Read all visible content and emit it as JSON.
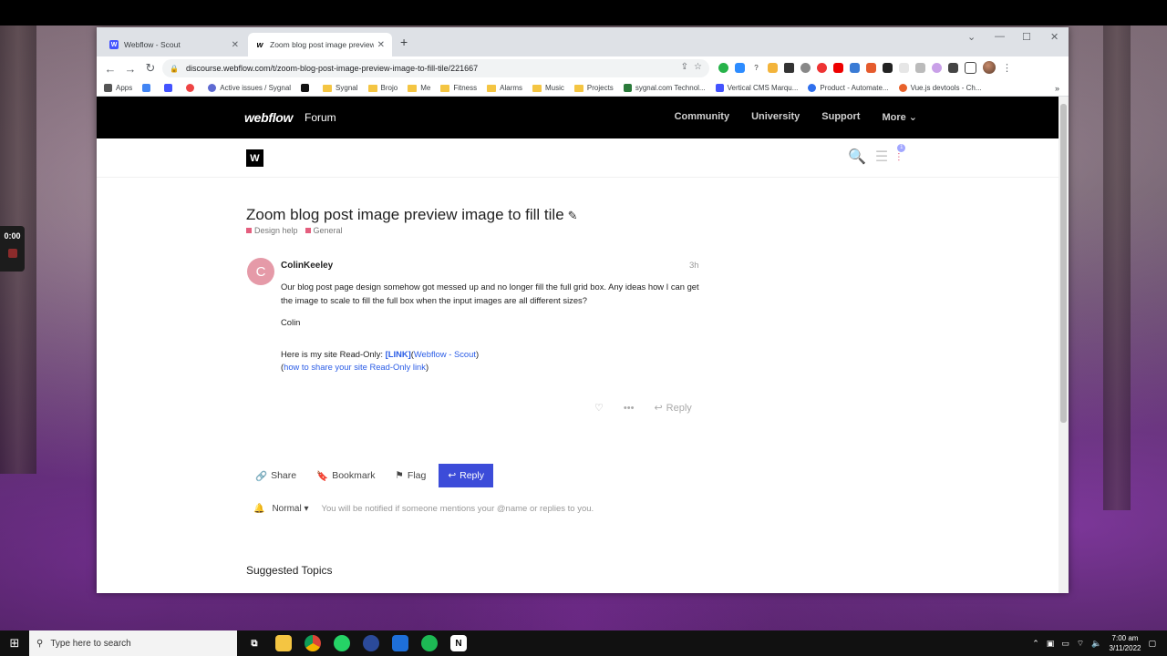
{
  "recorder": {
    "time": "0:00"
  },
  "browser": {
    "tabs": [
      {
        "title": "Webflow - Scout",
        "icon": "webflow-w"
      },
      {
        "title": "Zoom blog post image preview i",
        "icon": "webflow-w"
      }
    ],
    "new_tab_symbol": "+",
    "url": "discourse.webflow.com/t/zoom-blog-post-image-preview-image-to-fill-tile/221667",
    "bookmarks": [
      "Apps",
      "Active issues / Sygnal",
      "Sygnal",
      "Brojo",
      "Me",
      "Fitness",
      "Alarms",
      "Music",
      "Projects",
      "sygnal.com Technol...",
      "Vertical CMS Marqu...",
      "Product - Automate...",
      "Vue.js devtools - Ch..."
    ]
  },
  "site_header": {
    "logo": "webflow",
    "forum": "Forum",
    "nav": [
      "Community",
      "University",
      "Support",
      "More"
    ]
  },
  "discourse": {
    "logo_letter": "W",
    "notification_count": "1"
  },
  "topic": {
    "title": "Zoom blog post image preview image to fill tile",
    "categories": [
      "Design help",
      "General"
    ],
    "post": {
      "avatar_letter": "C",
      "username": "ColinKeeley",
      "time": "3h",
      "paragraph1": "Our blog post page design somehow got messed up and no longer fill the full grid box. Any ideas how I can get the image to scale to fill the full box when the input images are all different sizes?",
      "signature": "Colin",
      "readonly_prefix": "Here is my site Read-Only: ",
      "readonly_link": "[LINK]",
      "readonly_paren_open": "(",
      "readonly_site": "Webflow - Scout",
      "readonly_paren_close": ")",
      "howto_link": "how to share your site Read-Only link",
      "reply_label": "Reply"
    }
  },
  "footer_buttons": {
    "share": "Share",
    "bookmark": "Bookmark",
    "flag": "Flag",
    "reply": "Reply"
  },
  "notification": {
    "level": "Normal",
    "message": "You will be notified if someone mentions your @name or replies to you."
  },
  "suggested_title": "Suggested Topics",
  "taskbar": {
    "search_placeholder": "Type here to search",
    "time": "7:00 am",
    "date": "3/11/2022"
  },
  "colors": {
    "primary_button": "#3c4cd9",
    "category": "#e45e7e",
    "avatar": "#e59aa8"
  }
}
